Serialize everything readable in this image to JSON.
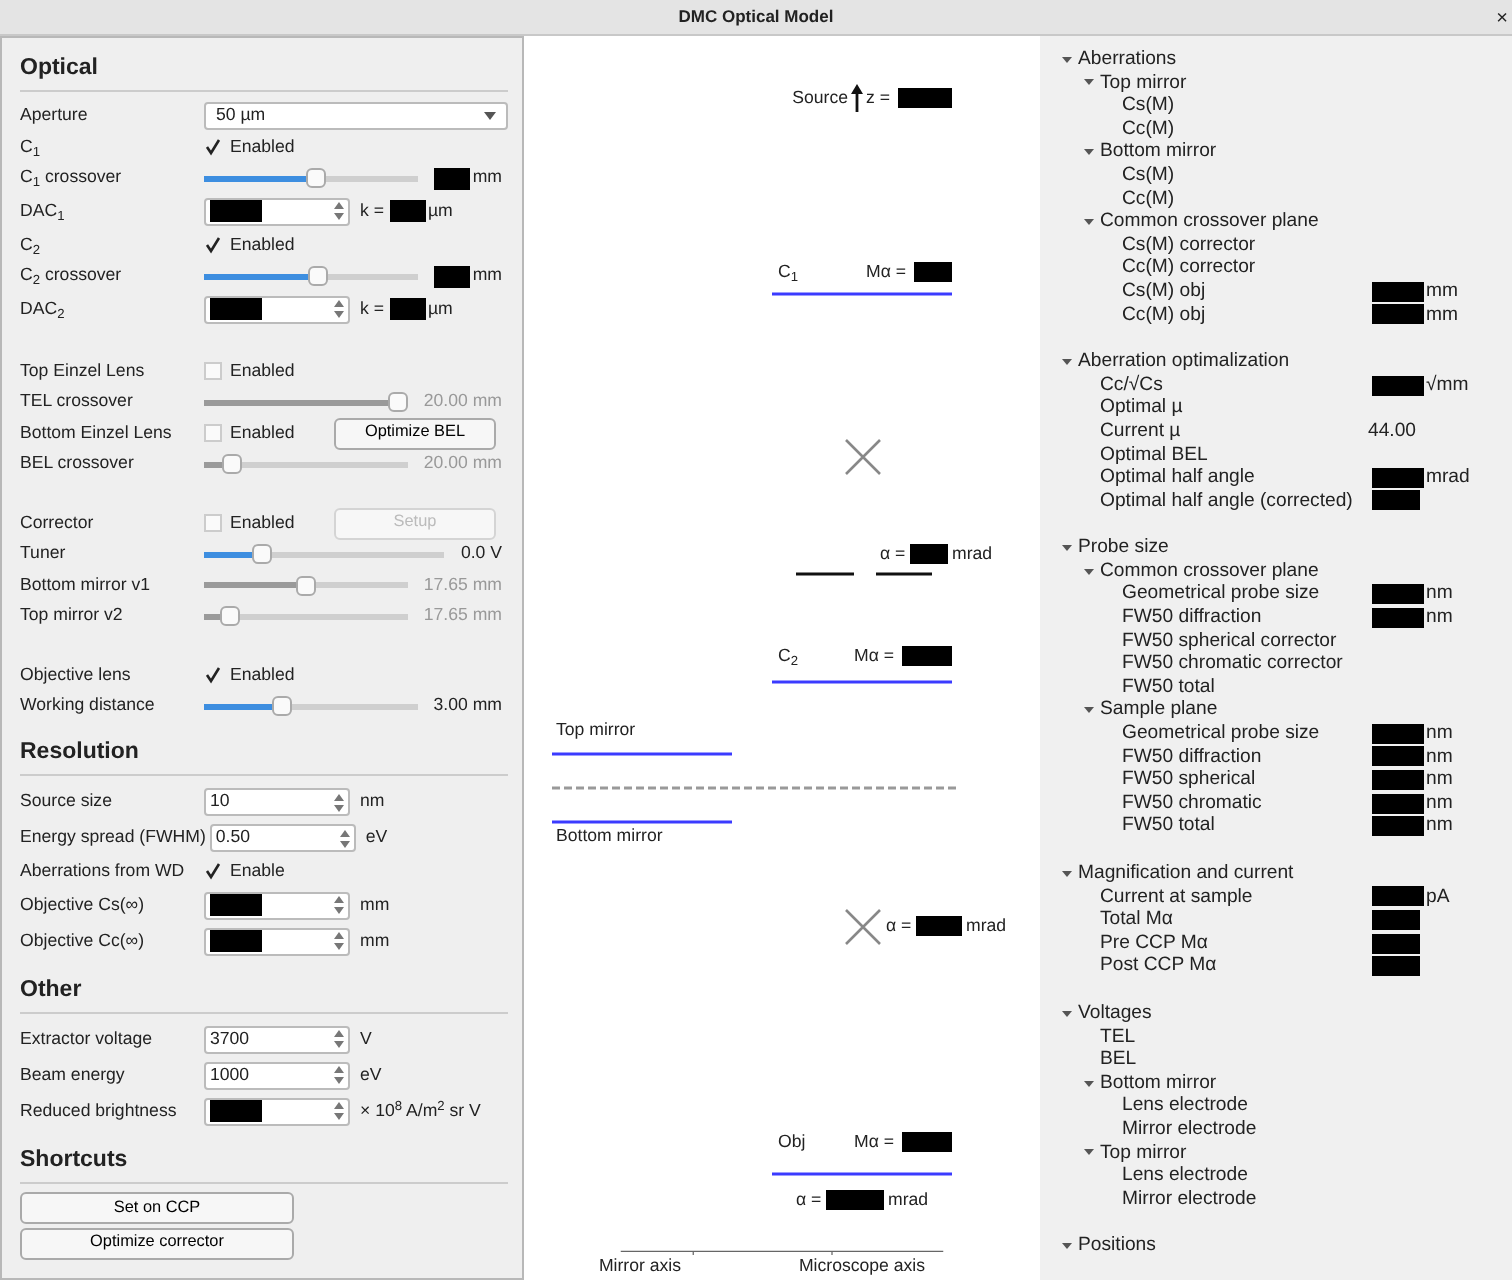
{
  "window": {
    "title": "DMC Optical Model",
    "close": "×"
  },
  "controls": [
    {
      "title": "Optical",
      "rows": [
        {
          "kind": "select",
          "label": "Aperture",
          "value": "50 µm"
        },
        {
          "kind": "check",
          "label": "C$_{1}$",
          "checked": true,
          "text": "Enabled"
        },
        {
          "kind": "slider",
          "label": "C$_{1}$ crossover",
          "level": 0.52,
          "disabled": false,
          "after": [
            {
              "hidden": true
            },
            {
              "text": "mm"
            }
          ]
        },
        {
          "kind": "spin",
          "label": "DAC$_{1}$",
          "hidden": true,
          "after": [
            {
              "text": "k ="
            },
            {
              "hidden": true
            },
            {
              "text": "µm"
            }
          ]
        },
        {
          "kind": "check",
          "label": "C$_{2}$",
          "checked": true,
          "text": "Enabled"
        },
        {
          "kind": "slider",
          "label": "C$_{2}$ crossover",
          "level": 0.53,
          "disabled": false,
          "after": [
            {
              "hidden": true
            },
            {
              "text": "mm"
            }
          ]
        },
        {
          "kind": "spin",
          "label": "DAC$_{2}$",
          "hidden": true,
          "after": [
            {
              "text": "k ="
            },
            {
              "hidden": true
            },
            {
              "text": "µm"
            }
          ]
        },
        {
          "kind": "gap"
        },
        {
          "kind": "check",
          "label": "Top Einzel Lens",
          "checked": false,
          "text": "Enabled"
        },
        {
          "kind": "slider",
          "label": "TEL crossover",
          "level": 1.0,
          "disabled": true,
          "after": [
            {
              "text": "20.00 mm"
            }
          ]
        },
        {
          "kind": "check",
          "label": "Bottom Einzel Lens",
          "checked": false,
          "text": "Enabled",
          "button": {
            "label": "Optimize BEL",
            "disabled": false
          }
        },
        {
          "kind": "slider",
          "label": "BEL crossover",
          "level": 0.1,
          "disabled": true,
          "after": [
            {
              "text": "20.00 mm"
            }
          ]
        },
        {
          "kind": "gap"
        },
        {
          "kind": "check",
          "label": "Corrector",
          "checked": false,
          "text": "Enabled",
          "button": {
            "label": "Setup",
            "disabled": true
          }
        },
        {
          "kind": "slider",
          "label": "Tuner",
          "level": 0.22,
          "disabled": false,
          "after": [
            {
              "text": "0.0 V"
            }
          ]
        },
        {
          "kind": "slider",
          "label": "Bottom mirror v1",
          "level": 0.5,
          "disabled": true,
          "after": [
            {
              "text": "17.65 mm"
            }
          ]
        },
        {
          "kind": "slider",
          "label": "Top mirror v2",
          "level": 0.09,
          "disabled": true,
          "after": [
            {
              "text": "17.65 mm"
            }
          ]
        },
        {
          "kind": "gap"
        },
        {
          "kind": "check",
          "label": "Objective lens",
          "checked": true,
          "text": "Enabled"
        },
        {
          "kind": "slider",
          "label": "Working distance",
          "level": 0.35,
          "disabled": false,
          "after": [
            {
              "text": "3.00 mm"
            }
          ]
        }
      ]
    },
    {
      "title": "Resolution",
      "rows": [
        {
          "kind": "spin",
          "label": "Source size",
          "value": "10",
          "after": [
            {
              "text": "nm"
            }
          ]
        },
        {
          "kind": "spin",
          "label": "Energy spread (FWHM)",
          "value": "0.50",
          "after": [
            {
              "text": "eV"
            }
          ]
        },
        {
          "kind": "check",
          "label": "Aberrations from WD",
          "checked": true,
          "text": "Enable"
        },
        {
          "kind": "spin",
          "label": "Objective Cs(∞)",
          "hidden": true,
          "after": [
            {
              "text": "mm"
            }
          ]
        },
        {
          "kind": "spin",
          "label": "Objective Cc(∞)",
          "hidden": true,
          "after": [
            {
              "text": "mm"
            }
          ]
        }
      ]
    },
    {
      "title": "Other",
      "rows": [
        {
          "kind": "spin",
          "label": "Extractor voltage",
          "value": "3700",
          "after": [
            {
              "text": "V"
            }
          ]
        },
        {
          "kind": "spin",
          "label": "Beam energy",
          "value": "1000",
          "after": [
            {
              "text": "eV"
            }
          ]
        },
        {
          "kind": "spin",
          "label": "Reduced brightness",
          "hidden": true,
          "after": [
            {
              "text": "× 10$^{8}$ A/m$^{2}$ sr V"
            }
          ]
        }
      ]
    },
    {
      "title": "Shortcuts",
      "rows": [
        {
          "kind": "button",
          "label": "Set on CCP"
        },
        {
          "kind": "button",
          "label": "Optimize corrector"
        }
      ]
    }
  ],
  "diagram": {
    "source": {
      "label": "Source",
      "z_label": "z ="
    },
    "lenses": [
      {
        "label": "C$_{1}$",
        "mag_label": "Mα ="
      },
      {
        "label": "C$_{2}$",
        "mag_label": "Mα ="
      },
      {
        "label": "Obj",
        "mag_label": "Mα ="
      }
    ],
    "angles": [
      {
        "label": "α =",
        "unit": "mrad"
      },
      {
        "label": "α =",
        "unit": "mrad"
      },
      {
        "label": "α =",
        "unit": "mrad"
      }
    ],
    "mirrors": [
      {
        "label": "Top mirror"
      },
      {
        "label": "Bottom mirror"
      }
    ],
    "axes": [
      {
        "label": "Mirror axis"
      },
      {
        "label": "Microscope axis"
      }
    ]
  },
  "results": [
    {
      "label": "Aberrations",
      "expanded": true,
      "children": [
        {
          "label": "Top mirror",
          "expanded": true,
          "children": [
            {
              "label": "Cs(M)"
            },
            {
              "label": "Cc(M)"
            }
          ]
        },
        {
          "label": "Bottom mirror",
          "expanded": true,
          "children": [
            {
              "label": "Cs(M)"
            },
            {
              "label": "Cc(M)"
            }
          ]
        },
        {
          "label": "Common crossover plane",
          "expanded": true,
          "children": [
            {
              "label": "Cs(M) corrector"
            },
            {
              "label": "Cc(M) corrector"
            },
            {
              "label": "Cs(M) obj",
              "hidden": true,
              "unit": "mm"
            },
            {
              "label": "Cc(M) obj",
              "hidden": true,
              "unit": "mm"
            }
          ]
        }
      ]
    },
    {
      "label": "Aberration optimalization",
      "expanded": true,
      "children": [
        {
          "label": "Cc/√Cs",
          "hidden": true,
          "unit": "√mm"
        },
        {
          "label": "Optimal µ"
        },
        {
          "label": "Current µ",
          "value": "44.00"
        },
        {
          "label": "Optimal BEL"
        },
        {
          "label": "Optimal half angle",
          "hidden": true,
          "unit": "mrad"
        },
        {
          "label": "Optimal half angle (corrected)",
          "hidden": true
        }
      ]
    },
    {
      "label": "Probe size",
      "expanded": true,
      "children": [
        {
          "label": "Common crossover plane",
          "expanded": true,
          "children": [
            {
              "label": "Geometrical probe size",
              "hidden": true,
              "unit": "nm"
            },
            {
              "label": "FW50 diffraction",
              "hidden": true,
              "unit": "nm"
            },
            {
              "label": "FW50 spherical corrector"
            },
            {
              "label": "FW50 chromatic corrector"
            },
            {
              "label": "FW50 total"
            }
          ]
        },
        {
          "label": "Sample plane",
          "expanded": true,
          "children": [
            {
              "label": "Geometrical probe size",
              "hidden": true,
              "unit": "nm"
            },
            {
              "label": "FW50 diffraction",
              "hidden": true,
              "unit": "nm"
            },
            {
              "label": "FW50 spherical",
              "hidden": true,
              "unit": "nm"
            },
            {
              "label": "FW50 chromatic",
              "hidden": true,
              "unit": "nm"
            },
            {
              "label": "FW50 total",
              "hidden": true,
              "unit": "nm"
            }
          ]
        }
      ]
    },
    {
      "label": "Magnification and current",
      "expanded": true,
      "children": [
        {
          "label": "Current at sample",
          "hidden": true,
          "unit": "pA"
        },
        {
          "label": "Total Mα",
          "hidden": true
        },
        {
          "label": "Pre CCP Mα",
          "hidden": true
        },
        {
          "label": "Post CCP Mα",
          "hidden": true
        }
      ]
    },
    {
      "label": "Voltages",
      "expanded": true,
      "children": [
        {
          "label": "TEL"
        },
        {
          "label": "BEL"
        },
        {
          "label": "Bottom mirror",
          "expanded": true,
          "children": [
            {
              "label": "Lens electrode"
            },
            {
              "label": "Mirror electrode"
            }
          ]
        },
        {
          "label": "Top mirror",
          "expanded": true,
          "children": [
            {
              "label": "Lens electrode"
            },
            {
              "label": "Mirror electrode"
            }
          ]
        }
      ]
    },
    {
      "label": "Positions",
      "expanded": true
    }
  ]
}
